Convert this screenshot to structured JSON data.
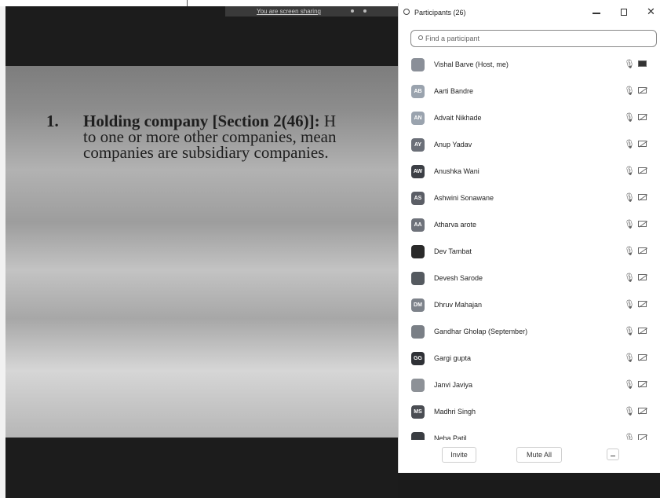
{
  "share_toolbar": {
    "label": "You are screen sharing"
  },
  "slide": {
    "item_number": "1.",
    "heading": "Holding company [Section 2(46)]:",
    "line1_tail": " H",
    "line2": "to one or more other companies, mean",
    "line3": "companies are subsidiary companies."
  },
  "panel": {
    "title": "Participants (26)",
    "search_placeholder": "Find a participant",
    "invite_label": "Invite",
    "mute_all_label": "Mute All"
  },
  "participants": [
    {
      "name": "Vishal Barve (Host, me)",
      "initials": "",
      "color": "#8a8f98",
      "photo": true,
      "host": true
    },
    {
      "name": "Aarti Bandre",
      "initials": "AB",
      "color": "#9aa3ae",
      "photo": false
    },
    {
      "name": "Advait Nikhade",
      "initials": "AN",
      "color": "#9aa3ae",
      "photo": false
    },
    {
      "name": "Anup Yadav",
      "initials": "AY",
      "color": "#6b6f78",
      "photo": false
    },
    {
      "name": "Anushka Wani",
      "initials": "AW",
      "color": "#3c3f45",
      "photo": false
    },
    {
      "name": "Ashwini Sonawane",
      "initials": "AS",
      "color": "#5b5e66",
      "photo": false
    },
    {
      "name": "Atharva arote",
      "initials": "AA",
      "color": "#6e727a",
      "photo": false
    },
    {
      "name": "Dev Tambat",
      "initials": "",
      "color": "#2a2a2a",
      "photo": true
    },
    {
      "name": "Devesh Sarode",
      "initials": "",
      "color": "#555a60",
      "photo": true
    },
    {
      "name": "Dhruv Mahajan",
      "initials": "DM",
      "color": "#7d828a",
      "photo": false
    },
    {
      "name": "Gandhar Gholap (September)",
      "initials": "",
      "color": "#7a7f86",
      "photo": true
    },
    {
      "name": "Gargi gupta",
      "initials": "GG",
      "color": "#2f3136",
      "photo": false
    },
    {
      "name": "Janvi Javiya",
      "initials": "",
      "color": "#8d9197",
      "photo": true
    },
    {
      "name": "Madhri Singh",
      "initials": "MS",
      "color": "#4a4d53",
      "photo": false
    },
    {
      "name": "Neha Patil",
      "initials": "",
      "color": "#3a3d42",
      "photo": true
    }
  ]
}
